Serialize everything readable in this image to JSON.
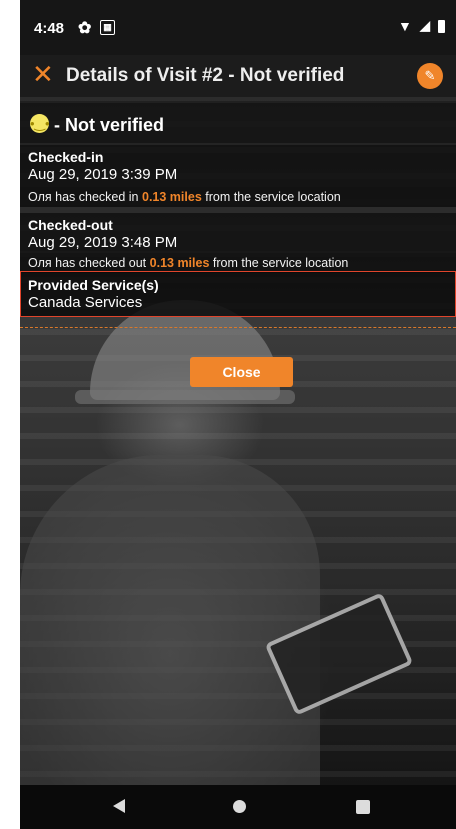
{
  "statusbar": {
    "time": "4:48",
    "icons": [
      "gear-icon",
      "sim-icon",
      "wifi-icon",
      "signal-icon",
      "battery-icon"
    ]
  },
  "appbar": {
    "close_glyph": "✕",
    "title": "Details of Visit #2 - Not verified",
    "action_icon": "add-note-icon"
  },
  "visit": {
    "status_label": "- Not verified",
    "status_icon": "neutral-face-icon",
    "checked_in": {
      "heading": "Checked-in",
      "datetime": "Aug 29, 2019 3:39 PM",
      "note_prefix": "Оля has checked in",
      "distance": "0.13 miles",
      "note_suffix": "from the service location"
    },
    "checked_out": {
      "heading": "Checked-out",
      "datetime": "Aug 29, 2019 3:48 PM",
      "note_prefix": "Оля has checked out",
      "distance": "0.13 miles",
      "note_suffix": "from the service location"
    },
    "provided_services": {
      "heading": "Provided Service(s)",
      "value": "Canada Services"
    }
  },
  "close_button": {
    "label": "Close"
  },
  "colors": {
    "accent": "#f0852a",
    "highlight_border": "#e0452c",
    "status_face": "#f5e663"
  },
  "navbar": {
    "icons": [
      "back-icon",
      "home-icon",
      "recents-icon"
    ]
  }
}
